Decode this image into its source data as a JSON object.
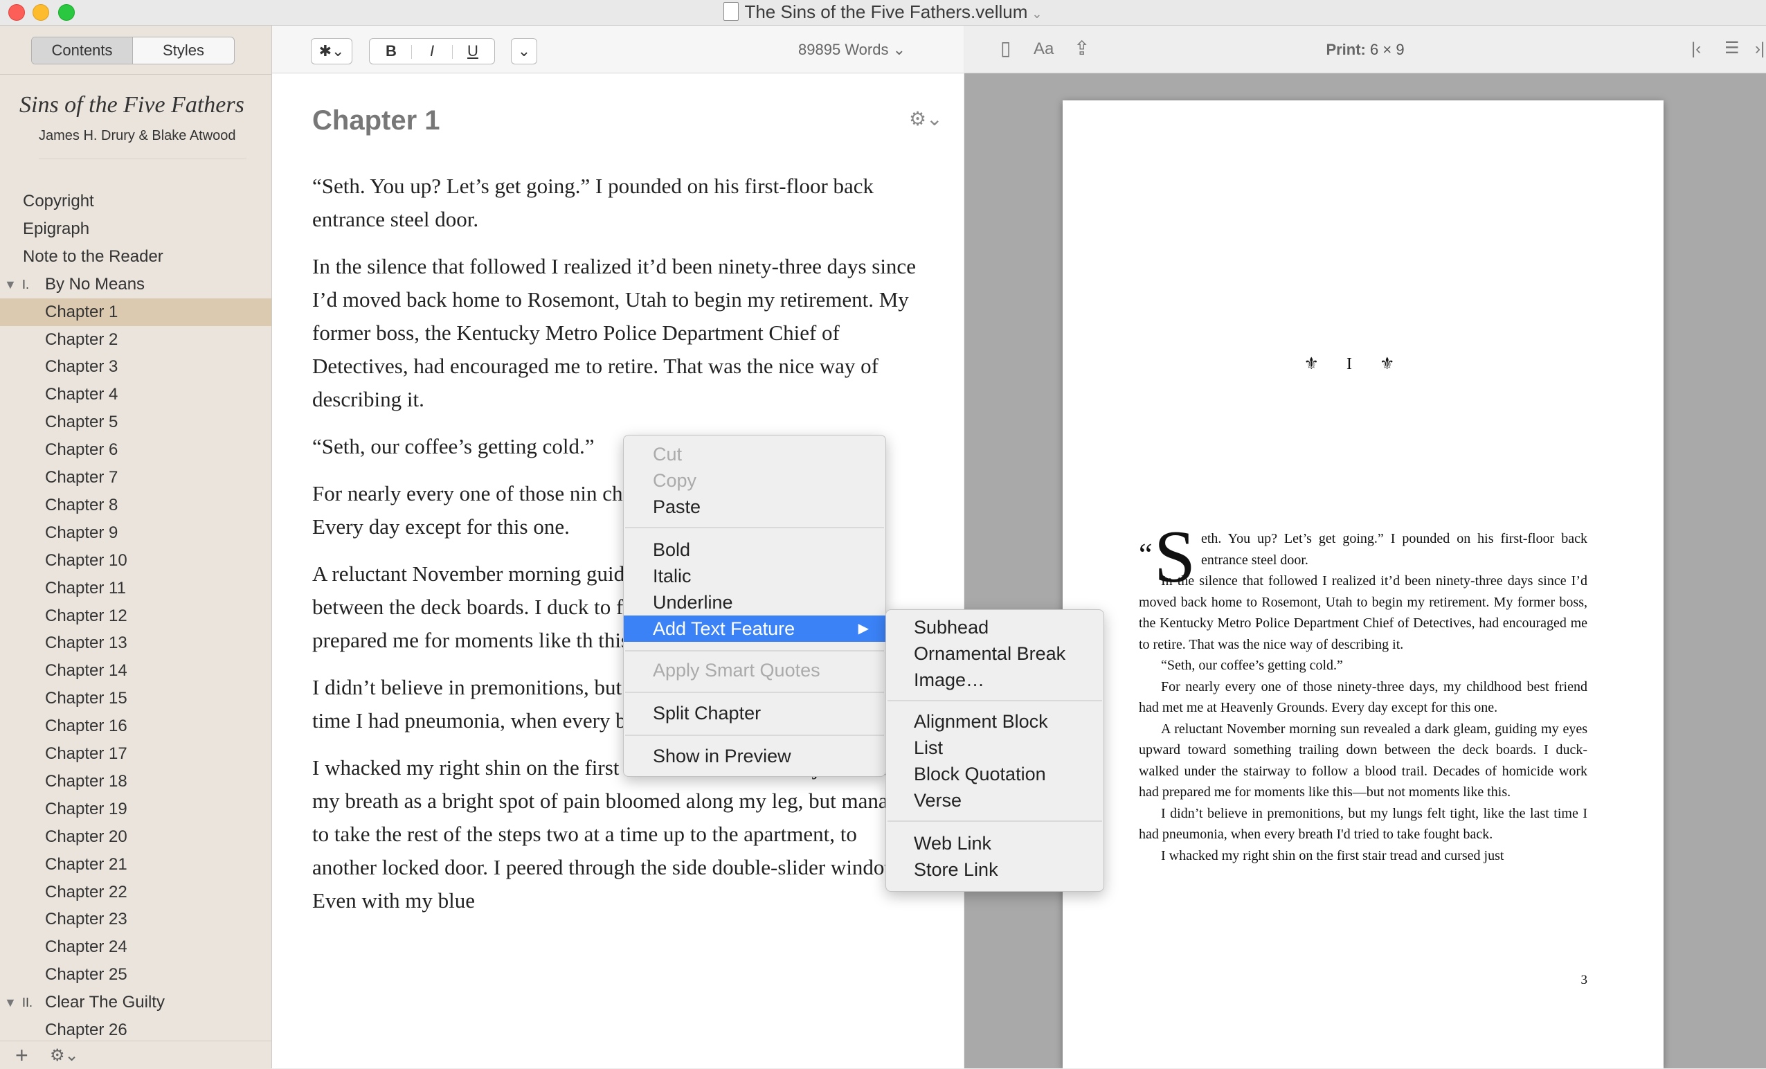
{
  "window": {
    "title": "The Sins of the Five Fathers.vellum"
  },
  "sidebar": {
    "tabs": {
      "contents": "Contents",
      "styles": "Styles"
    },
    "book_title": "Sins of the Five Fathers",
    "book_authors": "James H. Drury & Blake Atwood",
    "items": [
      {
        "label": "Copyright"
      },
      {
        "label": "Epigraph"
      },
      {
        "label": "Note to the Reader"
      },
      {
        "label": "By No Means",
        "number": "I."
      },
      {
        "label": "Chapter 1",
        "selected": true
      },
      {
        "label": "Chapter 2"
      },
      {
        "label": "Chapter 3"
      },
      {
        "label": "Chapter 4"
      },
      {
        "label": "Chapter 5"
      },
      {
        "label": "Chapter 6"
      },
      {
        "label": "Chapter 7"
      },
      {
        "label": "Chapter 8"
      },
      {
        "label": "Chapter 9"
      },
      {
        "label": "Chapter 10"
      },
      {
        "label": "Chapter 11"
      },
      {
        "label": "Chapter 12"
      },
      {
        "label": "Chapter 13"
      },
      {
        "label": "Chapter 14"
      },
      {
        "label": "Chapter 15"
      },
      {
        "label": "Chapter 16"
      },
      {
        "label": "Chapter 17"
      },
      {
        "label": "Chapter 18"
      },
      {
        "label": "Chapter 19"
      },
      {
        "label": "Chapter 20"
      },
      {
        "label": "Chapter 21"
      },
      {
        "label": "Chapter 22"
      },
      {
        "label": "Chapter 23"
      },
      {
        "label": "Chapter 24"
      },
      {
        "label": "Chapter 25"
      },
      {
        "label": "Clear The Guilty",
        "number": "II."
      },
      {
        "label": "Chapter 26"
      }
    ]
  },
  "editor": {
    "format": {
      "bold": "B",
      "italic": "I",
      "underline": "U"
    },
    "word_count": "89895",
    "word_unit": "Words",
    "chapter_heading": "Chapter 1",
    "paragraphs": [
      "“Seth. You up? Let’s get going.” I pounded on his first-floor back entrance steel door.",
      "In the silence that followed I realized it’d been ninety-three days since I’d moved back home to Rosemont, Utah to begin my retirement. My former boss, the Kentucky Metro Police Department Chief of Detectives, had encouraged me to retire. That was the nice way of describing it.",
      "“Seth, our coffee’s getting cold.”",
      "For nearly every one of those nin childhood best friend had met m Every day except for this one.",
      "A reluctant November morning guiding my eyes upward toward between the deck boards. I duck to follow a blood trail. Decades o prepared me for moments like th this.",
      "I didn’t believe in premonitions, but my lungs felt tight, like the last time I had pneumonia, when every breath I'd tried to take fought back.",
      "I whacked my right shin on the first stair tread and cursed just beneath my breath as a bright spot of pain bloomed along my leg, but managed to take the rest of the steps two at a time up to the apartment, to another locked door. I peered through the side double-slider window. Even with my blue"
    ]
  },
  "preview": {
    "print_label": "Print:",
    "print_size": "6 × 9",
    "ornament_left": "⚜",
    "ornament_numeral": "I",
    "ornament_right": "⚜",
    "drop_quote": "“",
    "drop_cap": "S",
    "first_paragraph": "eth. You up? Let’s get going.” I pounded on his first-floor back entrance steel door.",
    "paragraphs": [
      "In the silence that followed I realized it’d been ninety-three days since I’d moved back home to Rosemont, Utah to begin my retirement. My former boss, the Kentucky Metro Police Department Chief of Detectives, had encouraged me to retire. That was the nice way of describing it.",
      "“Seth, our coffee’s getting cold.”",
      "For nearly every one of those ninety-three days, my childhood best friend had met me at Heavenly Grounds. Every day except for this one.",
      "A reluctant November morning sun revealed a dark gleam, guiding my eyes upward toward something trailing down between the deck boards. I duck-walked under the stairway to follow a blood trail. Decades of homicide work had prepared me for moments like this—but not moments like this.",
      "I didn’t believe in premonitions, but my lungs felt tight, like the last time I had pneumonia, when every breath I'd tried to take fought back.",
      "I whacked my right shin on the first stair tread and cursed just"
    ],
    "page_number": "3"
  },
  "context_menu": {
    "cut": "Cut",
    "copy": "Copy",
    "paste": "Paste",
    "bold": "Bold",
    "italic": "Italic",
    "underline": "Underline",
    "add_text_feature": "Add Text Feature",
    "apply_smart_quotes": "Apply Smart Quotes",
    "split_chapter": "Split Chapter",
    "show_in_preview": "Show in Preview"
  },
  "submenu": {
    "subhead": "Subhead",
    "ornamental_break": "Ornamental Break",
    "image": "Image…",
    "alignment_block": "Alignment Block",
    "list": "List",
    "block_quotation": "Block Quotation",
    "verse": "Verse",
    "web_link": "Web Link",
    "store_link": "Store Link"
  },
  "colors": {
    "highlight": "#3b82f7",
    "sidebar_bg": "#eae4dc",
    "sidebar_selected": "#dccab0",
    "preview_bg": "#a9a9a9"
  }
}
